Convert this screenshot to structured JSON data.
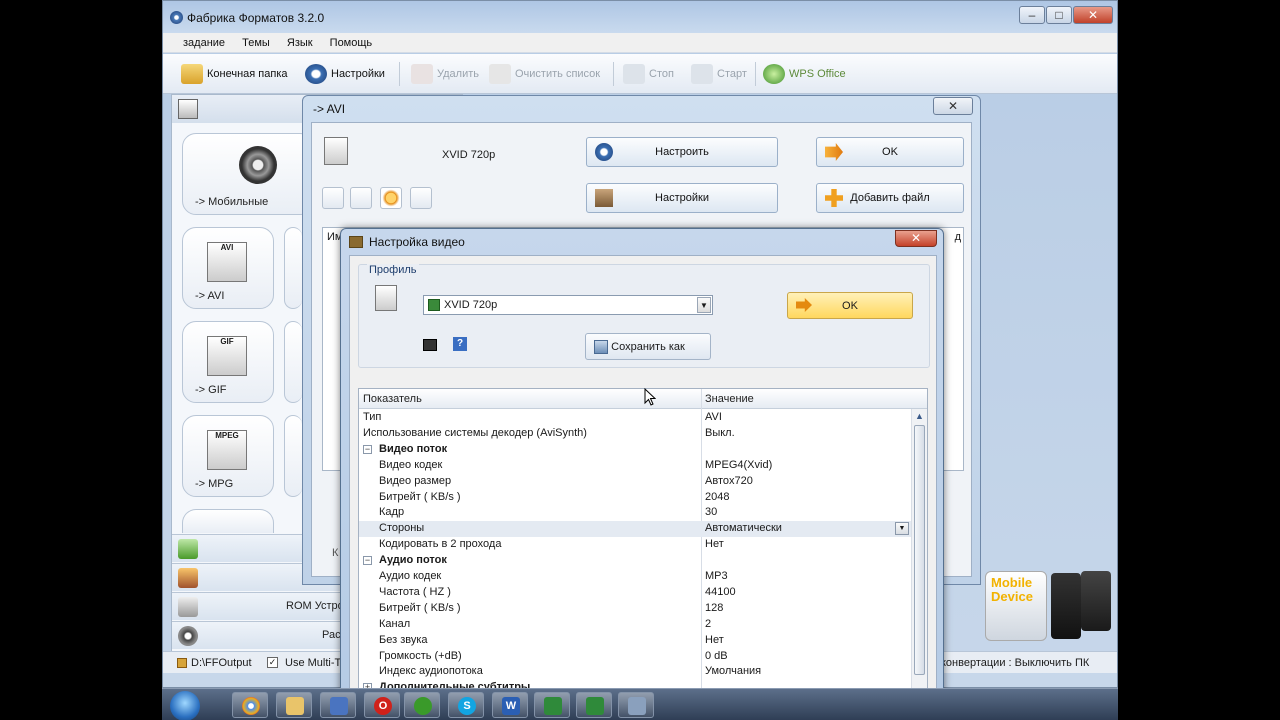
{
  "app": {
    "title": "Фабрика Форматов 3.2.0"
  },
  "menu": [
    "задание",
    "Темы",
    "Язык",
    "Помощь"
  ],
  "toolbar": {
    "output_folder": "Конечная папка",
    "settings": "Настройки",
    "delete": "Удалить",
    "clear_list": "Очистить список",
    "stop": "Стоп",
    "start": "Старт",
    "wps": "WPS Office"
  },
  "tiles": [
    "-> Мобильные",
    "-> AVI",
    "-> GIF",
    "-> MPG"
  ],
  "tile_badges": [
    "AVI",
    "GIF",
    "MPEG"
  ],
  "categories": {
    "rom": "ROM Устро",
    "misc": "Рас",
    "cat_first_letter": "К"
  },
  "statusbar": {
    "folder": "D:\\FFOutput",
    "multithread": "Use Multi-T",
    "after": "конвертации : Выключить ПК"
  },
  "avi_window": {
    "title": "-> AVI",
    "profile": "XVID 720p",
    "configure": "Настроить",
    "settings": "Настройки",
    "ok": "OK",
    "add_file": "Добавить файл",
    "list_col_first": "Им",
    "list_col_last": "д"
  },
  "video_dialog": {
    "title": "Настройка видео",
    "group_label": "Профиль",
    "profile_value": "XVID 720p",
    "ok": "OK",
    "save_as": "Сохранить как",
    "help": "?",
    "col_param": "Показатель",
    "col_value": "Значение",
    "rows": [
      {
        "k": "Тип",
        "v": "AVI",
        "type": "top"
      },
      {
        "k": "Использование системы декодер (AviSynth)",
        "v": "Выкл.",
        "type": "top"
      },
      {
        "k": "Видео поток",
        "v": "",
        "type": "sec"
      },
      {
        "k": "Видео кодек",
        "v": "MPEG4(Xvid)",
        "type": "ind"
      },
      {
        "k": "Видео размер",
        "v": "Автоx720",
        "type": "ind"
      },
      {
        "k": "Битрейт ( KB/s )",
        "v": "2048",
        "type": "ind"
      },
      {
        "k": "Кадр",
        "v": "30",
        "type": "ind"
      },
      {
        "k": "Стороны",
        "v": "Автоматически",
        "type": "ind-hl"
      },
      {
        "k": "Кодировать в 2 прохода",
        "v": "Нет",
        "type": "ind"
      },
      {
        "k": "Аудио поток",
        "v": "",
        "type": "sec"
      },
      {
        "k": "Аудио кодек",
        "v": "MP3",
        "type": "ind"
      },
      {
        "k": "Частота ( HZ )",
        "v": "44100",
        "type": "ind"
      },
      {
        "k": "Битрейт ( KB/s )",
        "v": "128",
        "type": "ind"
      },
      {
        "k": "Канал",
        "v": "2",
        "type": "ind"
      },
      {
        "k": "Без звука",
        "v": "Нет",
        "type": "ind"
      },
      {
        "k": "Громкость (+dB)",
        "v": "0 dB",
        "type": "ind"
      },
      {
        "k": "Индекс аудиопотока",
        "v": "Умолчания",
        "type": "ind"
      },
      {
        "k": "Дополнительные субтитры",
        "v": "",
        "type": "sec-c"
      }
    ]
  },
  "promo": {
    "line1": "Mobile",
    "line2": "Device"
  },
  "colors": {
    "ok_bg": "#ffd75e",
    "accent": "#2a6fc0"
  }
}
